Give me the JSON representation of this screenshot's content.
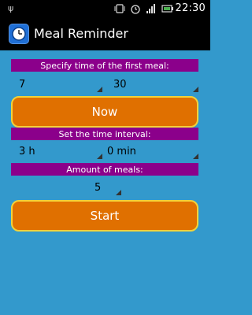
{
  "statusbar": {
    "left_glyph": "ψ",
    "time": "22:30"
  },
  "app": {
    "title": "Meal Reminder",
    "icon": "clock-icon"
  },
  "first_meal": {
    "header": "Specify time of the first meal:",
    "hour": "7",
    "minute": "30",
    "now_button": "Now"
  },
  "interval": {
    "header": "Set the time interval:",
    "hours": "3 h",
    "minutes": "0 min"
  },
  "meals": {
    "header": "Amount of meals:",
    "count": "5"
  },
  "start_button": "Start",
  "colors": {
    "background": "#3399cc",
    "header": "#8b008b",
    "button": "#e07000",
    "button_border": "#f2d23a"
  }
}
